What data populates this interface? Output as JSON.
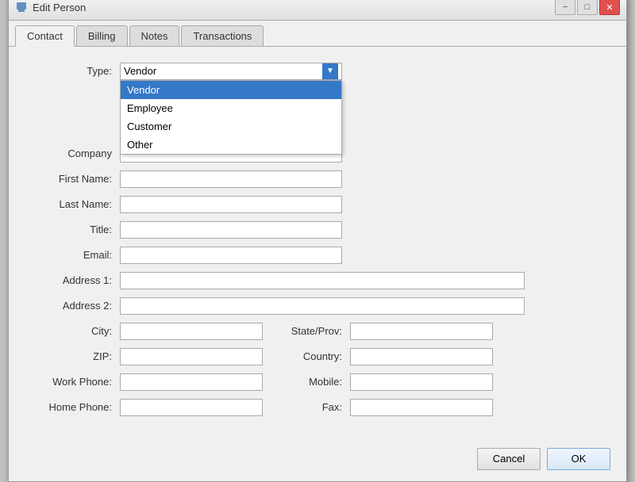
{
  "window": {
    "title": "Edit Person",
    "icon": "person-icon"
  },
  "titlebar_controls": {
    "minimize": "−",
    "maximize": "□",
    "close": "✕"
  },
  "tabs": [
    {
      "id": "contact",
      "label": "Contact",
      "active": true
    },
    {
      "id": "billing",
      "label": "Billing",
      "active": false
    },
    {
      "id": "notes",
      "label": "Notes",
      "active": false
    },
    {
      "id": "transactions",
      "label": "Transactions",
      "active": false
    }
  ],
  "form": {
    "type_label": "Type:",
    "type_value": "Vendor",
    "type_options": [
      "Vendor",
      "Employee",
      "Customer",
      "Other"
    ],
    "company_label": "Company",
    "company_value": "",
    "first_name_label": "First Name:",
    "first_name_value": "",
    "last_name_label": "Last Name:",
    "last_name_value": "",
    "title_label": "Title:",
    "title_value": "",
    "email_label": "Email:",
    "email_value": "",
    "address1_label": "Address 1:",
    "address1_value": "",
    "address2_label": "Address 2:",
    "address2_value": "",
    "city_label": "City:",
    "city_value": "",
    "state_label": "State/Prov:",
    "state_value": "",
    "zip_label": "ZIP:",
    "zip_value": "",
    "country_label": "Country:",
    "country_value": "",
    "work_phone_label": "Work Phone:",
    "work_phone_value": "",
    "mobile_label": "Mobile:",
    "mobile_value": "",
    "home_phone_label": "Home Phone:",
    "home_phone_value": "",
    "fax_label": "Fax:",
    "fax_value": ""
  },
  "footer": {
    "cancel_label": "Cancel",
    "ok_label": "OK"
  },
  "colors": {
    "selected_blue": "#3478c8"
  }
}
